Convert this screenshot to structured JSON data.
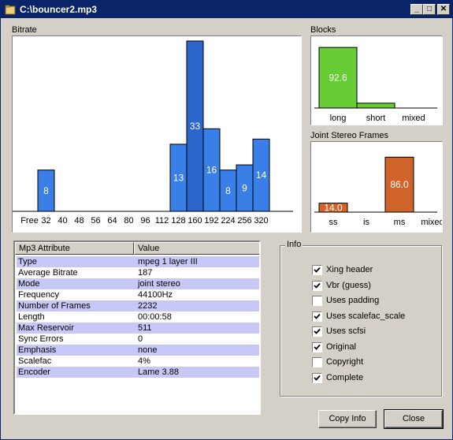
{
  "window": {
    "title": "C:\\bouncer2.mp3"
  },
  "bitrate": {
    "label": "Bitrate",
    "chart_data": {
      "type": "bar",
      "categories": [
        "Free",
        "32",
        "40",
        "48",
        "56",
        "64",
        "80",
        "96",
        "112",
        "128",
        "160",
        "192",
        "224",
        "256",
        "320"
      ],
      "values": [
        0,
        8,
        0,
        0,
        0,
        0,
        0,
        0,
        0,
        13,
        33,
        16,
        8,
        9,
        14
      ],
      "data_labels": [
        "",
        "8",
        "",
        "",
        "",
        "",
        "",
        "",
        "",
        "13",
        "33",
        "16",
        "8",
        "9",
        "14"
      ],
      "ylim": [
        0,
        33
      ],
      "bar_color": "#3a7ee8",
      "bar_color_peak": "#2a66cc"
    }
  },
  "blocks": {
    "label": "Blocks",
    "chart_data": {
      "type": "bar",
      "categories": [
        "long",
        "short",
        "mixed"
      ],
      "values": [
        92.6,
        7.4,
        0
      ],
      "data_labels": [
        "92.6",
        "",
        ""
      ],
      "ylim": [
        0,
        100
      ],
      "bar_color": "#66cc33"
    }
  },
  "joint_stereo": {
    "label": "Joint Stereo Frames",
    "chart_data": {
      "type": "bar",
      "categories": [
        "ss",
        "is",
        "ms",
        "mixed"
      ],
      "values": [
        14.0,
        0,
        86.0,
        0
      ],
      "data_labels": [
        "14.0",
        "",
        "86.0",
        ""
      ],
      "ylim": [
        0,
        100
      ],
      "bar_color": "#d0642a"
    }
  },
  "attributes": {
    "headers": [
      "Mp3 Attribute",
      "Value"
    ],
    "rows": [
      {
        "name": "Type",
        "value": "mpeg 1 layer III"
      },
      {
        "name": "Average Bitrate",
        "value": "187"
      },
      {
        "name": "Mode",
        "value": "joint stereo"
      },
      {
        "name": "Frequency",
        "value": "44100Hz"
      },
      {
        "name": "Number of Frames",
        "value": "2232"
      },
      {
        "name": "Length",
        "value": "00:00:58"
      },
      {
        "name": "Max Reservoir",
        "value": "511"
      },
      {
        "name": "Sync Errors",
        "value": "0"
      },
      {
        "name": "Emphasis",
        "value": "none"
      },
      {
        "name": "Scalefac",
        "value": "4%"
      },
      {
        "name": "Encoder",
        "value": "Lame 3.88"
      }
    ]
  },
  "info": {
    "label": "Info",
    "items": [
      {
        "label": "Xing header",
        "checked": true
      },
      {
        "label": "Vbr (guess)",
        "checked": true
      },
      {
        "label": "Uses padding",
        "checked": false
      },
      {
        "label": "Uses scalefac_scale",
        "checked": true
      },
      {
        "label": "Uses scfsi",
        "checked": true
      },
      {
        "label": "Original",
        "checked": true
      },
      {
        "label": "Copyright",
        "checked": false
      },
      {
        "label": "Complete",
        "checked": true
      }
    ]
  },
  "buttons": {
    "copy_info": "Copy Info",
    "close": "Close"
  },
  "titlebar_buttons": {
    "minimize": "_",
    "maximize": "□",
    "close": "✕"
  }
}
